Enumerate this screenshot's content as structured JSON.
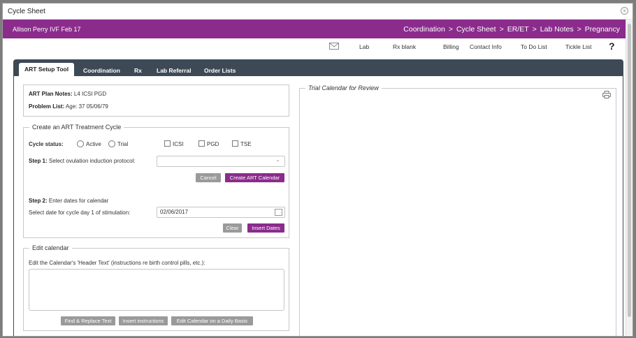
{
  "window": {
    "title": "Cycle Sheet"
  },
  "header": {
    "patient": "Allison Perry IVF Feb 17",
    "breadcrumbs": [
      "Coordination",
      "Cycle Sheet",
      "ER/ET",
      "Lab Notes",
      "Pregnancy"
    ],
    "separator": ">"
  },
  "toolbar": {
    "items": [
      "Lab",
      "Rx blank",
      "Billing",
      "Contact Info",
      "To Do List",
      "Tickle List"
    ],
    "help": "?"
  },
  "tabs": [
    "ART Setup Tool",
    "Coordination",
    "Rx",
    "Lab Referral",
    "Order Lists"
  ],
  "plan": {
    "art_label": "ART Plan Notes:",
    "art_value": "L4 ICSI PGD",
    "problem_label": "Problem List:",
    "problem_value": "Age: 37 05/06/79"
  },
  "create": {
    "legend": "Create an ART Treatment Cycle",
    "status_label": "Cycle status:",
    "radio_active": "Active",
    "radio_trial": "Trial",
    "chk_icsi": "ICSI",
    "chk_pgd": "PGD",
    "chk_tse": "TSE",
    "step1_label": "Step 1:",
    "step1_text": "Select ovulation induction protocol:",
    "cancel": "Cancel",
    "create_calendar": "Create ART Calendar",
    "step2_label": "Step 2:",
    "step2_text": "Enter dates for calendar",
    "date_prompt": "Select date for cycle day 1 of stimulation:",
    "date_value": "02/06/2017",
    "clear": "Clear",
    "insert_dates": "Insert Dates"
  },
  "edit": {
    "legend": "Edit calendar",
    "instructions": "Edit the Calendar's 'Header Text' (instructions re birth control pills, etc.):",
    "find_replace": "Find & Replace Text",
    "insert_instructions": "Insert instructions",
    "daily": "Edit Calendar on a Daily Basis"
  },
  "trial": {
    "legend": "Trial Calendar for Review"
  },
  "colors": {
    "accent": "#8b2c8c",
    "tabbar": "#3d4a55",
    "gray_button": "#9a9a9a"
  }
}
